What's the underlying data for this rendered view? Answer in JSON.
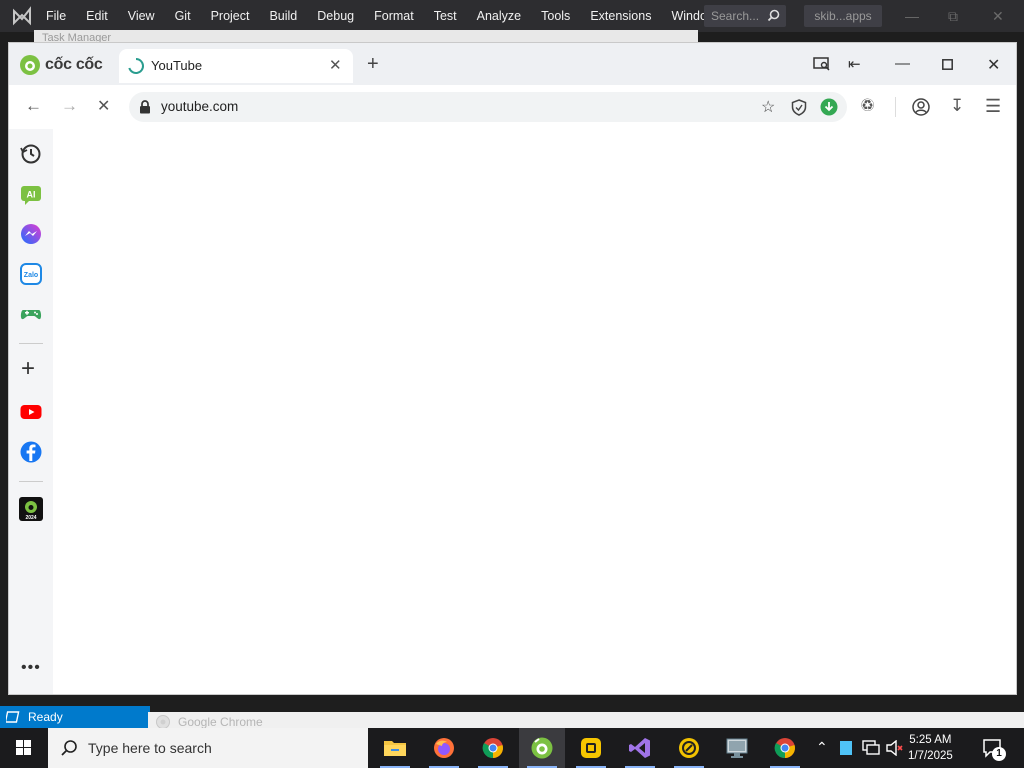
{
  "vs": {
    "menu": [
      "File",
      "Edit",
      "View",
      "Git",
      "Project",
      "Build",
      "Debug",
      "Format",
      "Test",
      "Analyze",
      "Tools",
      "Extensions",
      "Window"
    ],
    "search_placeholder": "Search...",
    "solution_name": "skib...apps",
    "status_text": "Ready"
  },
  "background_window": {
    "title": "Task Manager"
  },
  "browser": {
    "brand": "cốc cốc",
    "tab_title": "YouTube",
    "url": "youtube.com",
    "sidebar_items": [
      "history-icon",
      "ai-chat-icon",
      "messenger-icon",
      "zalo-icon",
      "game-icon",
      "add-icon",
      "youtube-icon",
      "facebook-icon",
      "coccoc-2024-icon",
      "more-icon"
    ]
  },
  "chrome_strip_title": "Google Chrome",
  "taskbar": {
    "search_placeholder": "Type here to search",
    "apps": [
      "file-explorer",
      "firefox",
      "chrome",
      "coccoc",
      "app-yellow",
      "visual-studio",
      "app-ring",
      "remote-desktop",
      "chrome-2"
    ],
    "time": "5:25 AM",
    "date": "1/7/2025",
    "notification_count": "1"
  },
  "colors": {
    "accent": "#007acc",
    "coccoc_green": "#7cc142"
  }
}
